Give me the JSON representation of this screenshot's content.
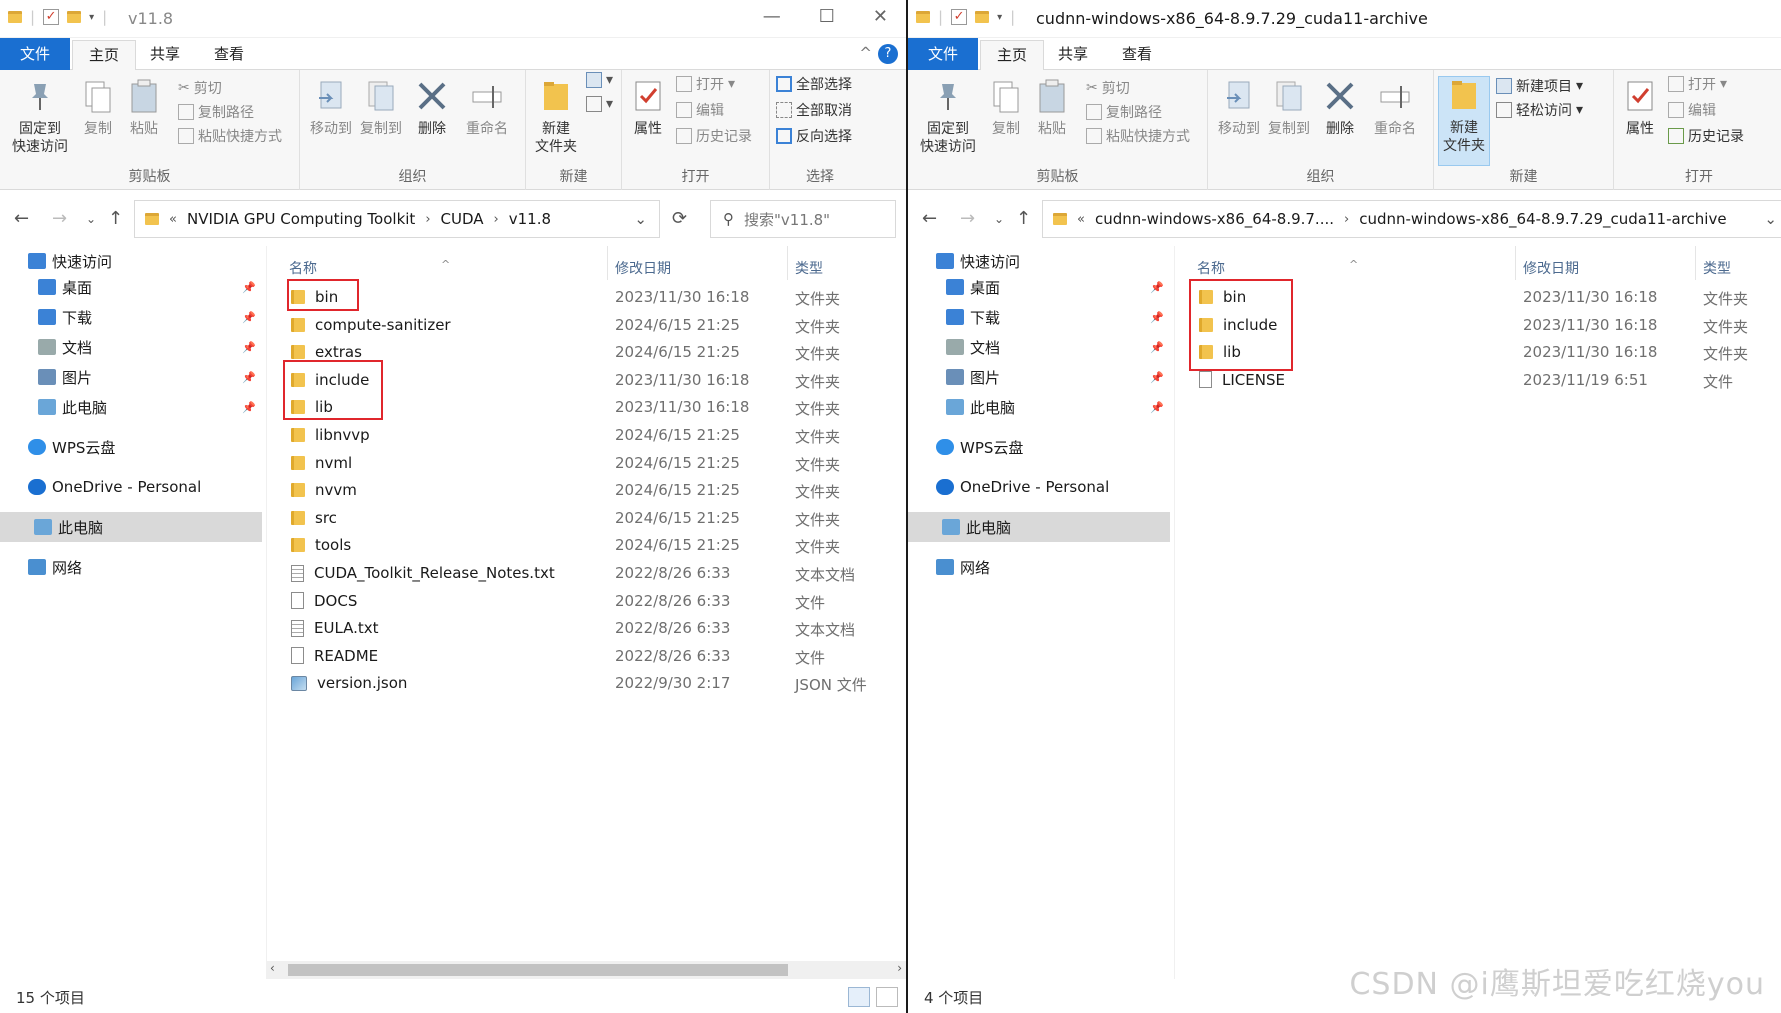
{
  "left": {
    "title": "v11.8",
    "tabs": [
      "文件",
      "主页",
      "共享",
      "查看"
    ],
    "ribbon": {
      "pin_label": "固定到\n快速访问",
      "copy": "复制",
      "paste": "粘贴",
      "cut": "剪切",
      "copy_path": "复制路径",
      "paste_shortcut": "粘贴快捷方式",
      "move_to": "移动到",
      "copy_to": "复制到",
      "delete": "删除",
      "rename": "重命名",
      "new_folder": "新建\n文件夹",
      "properties": "属性",
      "open": "打开",
      "edit": "编辑",
      "history": "历史记录",
      "select_all": "全部选择",
      "select_none": "全部取消",
      "invert": "反向选择",
      "groups": [
        "剪贴板",
        "组织",
        "新建",
        "打开",
        "选择"
      ]
    },
    "address": [
      "NVIDIA GPU Computing Toolkit",
      "CUDA",
      "v11.8"
    ],
    "search_placeholder": "搜索\"v11.8\"",
    "columns": [
      "名称",
      "修改日期",
      "类型"
    ],
    "files": [
      {
        "name": "bin",
        "date": "2023/11/30 16:18",
        "type": "文件夹",
        "icon": "folder"
      },
      {
        "name": "compute-sanitizer",
        "date": "2024/6/15 21:25",
        "type": "文件夹",
        "icon": "folder"
      },
      {
        "name": "extras",
        "date": "2024/6/15 21:25",
        "type": "文件夹",
        "icon": "folder"
      },
      {
        "name": "include",
        "date": "2023/11/30 16:18",
        "type": "文件夹",
        "icon": "folder"
      },
      {
        "name": "lib",
        "date": "2023/11/30 16:18",
        "type": "文件夹",
        "icon": "folder"
      },
      {
        "name": "libnvvp",
        "date": "2024/6/15 21:25",
        "type": "文件夹",
        "icon": "folder"
      },
      {
        "name": "nvml",
        "date": "2024/6/15 21:25",
        "type": "文件夹",
        "icon": "folder"
      },
      {
        "name": "nvvm",
        "date": "2024/6/15 21:25",
        "type": "文件夹",
        "icon": "folder"
      },
      {
        "name": "src",
        "date": "2024/6/15 21:25",
        "type": "文件夹",
        "icon": "folder"
      },
      {
        "name": "tools",
        "date": "2024/6/15 21:25",
        "type": "文件夹",
        "icon": "folder"
      },
      {
        "name": "CUDA_Toolkit_Release_Notes.txt",
        "date": "2022/8/26 6:33",
        "type": "文本文档",
        "icon": "txt"
      },
      {
        "name": "DOCS",
        "date": "2022/8/26 6:33",
        "type": "文件",
        "icon": "file"
      },
      {
        "name": "EULA.txt",
        "date": "2022/8/26 6:33",
        "type": "文本文档",
        "icon": "txt"
      },
      {
        "name": "README",
        "date": "2022/8/26 6:33",
        "type": "文件",
        "icon": "file"
      },
      {
        "name": "version.json",
        "date": "2022/9/30 2:17",
        "type": "JSON 文件",
        "icon": "json"
      }
    ],
    "status": "15 个项目"
  },
  "right": {
    "title": "cudnn-windows-x86_64-8.9.7.29_cuda11-archive",
    "tabs": [
      "文件",
      "主页",
      "共享",
      "查看"
    ],
    "ribbon": {
      "pin_label": "固定到\n快速访问",
      "copy": "复制",
      "paste": "粘贴",
      "cut": "剪切",
      "copy_path": "复制路径",
      "paste_shortcut": "粘贴快捷方式",
      "move_to": "移动到",
      "copy_to": "复制到",
      "delete": "删除",
      "rename": "重命名",
      "new_folder": "新建\n文件夹",
      "new_item": "新建项目",
      "easy_access": "轻松访问",
      "properties": "属性",
      "open": "打开",
      "edit": "编辑",
      "history": "历史记录",
      "groups": [
        "剪贴板",
        "组织",
        "新建",
        "打开"
      ]
    },
    "address": [
      "cudnn-windows-x86_64-8.9.7....",
      "cudnn-windows-x86_64-8.9.7.29_cuda11-archive"
    ],
    "columns": [
      "名称",
      "修改日期",
      "类型"
    ],
    "files": [
      {
        "name": "bin",
        "date": "2023/11/30 16:18",
        "type": "文件夹",
        "icon": "folder"
      },
      {
        "name": "include",
        "date": "2023/11/30 16:18",
        "type": "文件夹",
        "icon": "folder"
      },
      {
        "name": "lib",
        "date": "2023/11/30 16:18",
        "type": "文件夹",
        "icon": "folder"
      },
      {
        "name": "LICENSE",
        "date": "2023/11/19 6:51",
        "type": "文件",
        "icon": "file"
      }
    ],
    "status": "4 个项目"
  },
  "nav": [
    {
      "label": "快速访问",
      "icon": "star-icon",
      "pinned": false
    },
    {
      "label": "桌面",
      "icon": "desktop-icon",
      "pinned": true
    },
    {
      "label": "下载",
      "icon": "download-icon",
      "pinned": true
    },
    {
      "label": "文档",
      "icon": "document-icon",
      "pinned": true
    },
    {
      "label": "图片",
      "icon": "picture-icon",
      "pinned": true
    },
    {
      "label": "此电脑",
      "icon": "computer-icon",
      "pinned": true
    },
    {
      "label": "WPS云盘",
      "icon": "cloud-icon",
      "pinned": false
    },
    {
      "label": "OneDrive - Personal",
      "icon": "onedrive-icon",
      "pinned": false
    },
    {
      "label": "此电脑",
      "icon": "computer-icon",
      "pinned": false
    },
    {
      "label": "网络",
      "icon": "network-icon",
      "pinned": false
    }
  ],
  "watermark": "CSDN @i鹰斯坦爱吃红烧you"
}
